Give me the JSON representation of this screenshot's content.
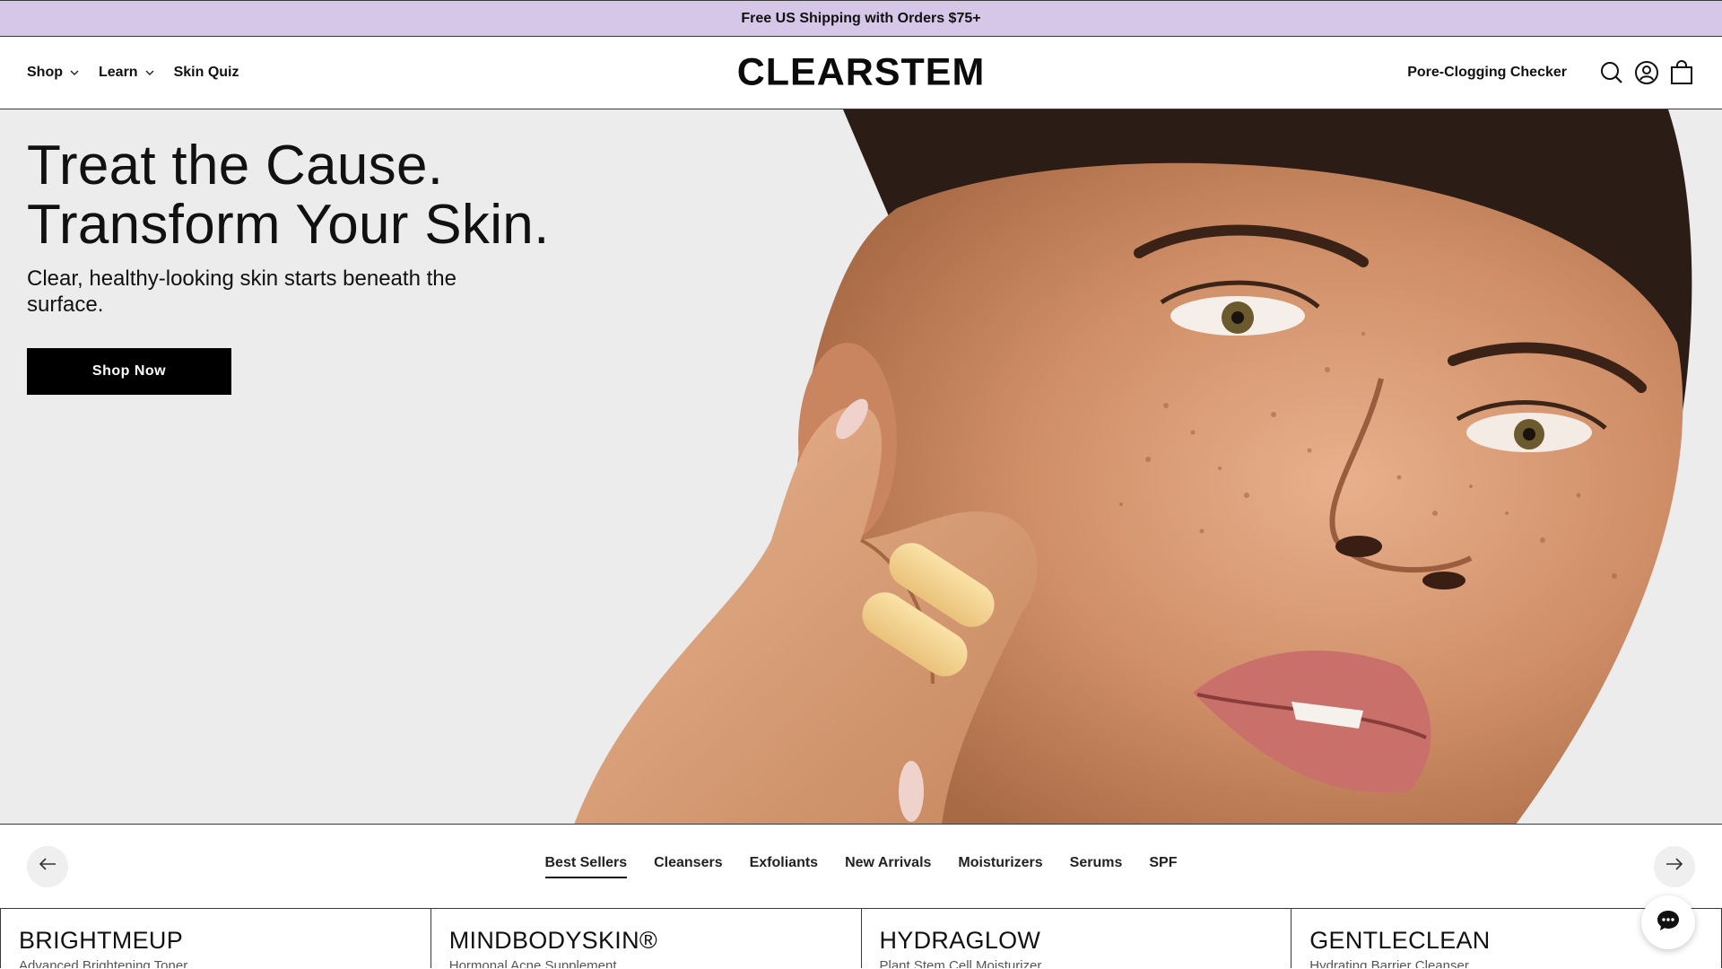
{
  "announcement": {
    "text": "Free US Shipping with Orders $75+"
  },
  "header": {
    "nav": [
      {
        "label": "Shop",
        "has_dropdown": true
      },
      {
        "label": "Learn",
        "has_dropdown": true
      },
      {
        "label": "Skin Quiz",
        "has_dropdown": false
      }
    ],
    "logo": "CLEARSTEM",
    "pore_checker": "Pore-Clogging Checker",
    "icons": [
      "search-icon",
      "account-icon",
      "cart-icon"
    ]
  },
  "hero": {
    "title_line1": "Treat the Cause.",
    "title_line2": "Transform Your Skin.",
    "subtitle": "Clear, healthy-looking skin starts beneath the surface.",
    "cta": "Shop Now"
  },
  "collections": {
    "tabs": [
      "Best Sellers",
      "Cleansers",
      "Exfoliants",
      "New Arrivals",
      "Moisturizers",
      "Serums",
      "SPF"
    ],
    "active_tab": "Best Sellers",
    "prev_icon": "arrow-left-icon",
    "next_icon": "arrow-right-icon"
  },
  "products": [
    {
      "name": "BRIGHTMEUP",
      "description": "Advanced Brightening Toner"
    },
    {
      "name": "MINDBODYSKIN®",
      "description": "Hormonal Acne Supplement"
    },
    {
      "name": "HYDRAGLOW",
      "description": "Plant Stem Cell Moisturizer"
    },
    {
      "name": "GENTLECLEAN",
      "description": "Hydrating Barrier Cleanser"
    }
  ],
  "chat": {
    "icon": "chat-icon"
  },
  "colors": {
    "announcement_bg": "#d6c7e8",
    "cta_bg": "#000000",
    "hero_bg": "#ececec"
  }
}
